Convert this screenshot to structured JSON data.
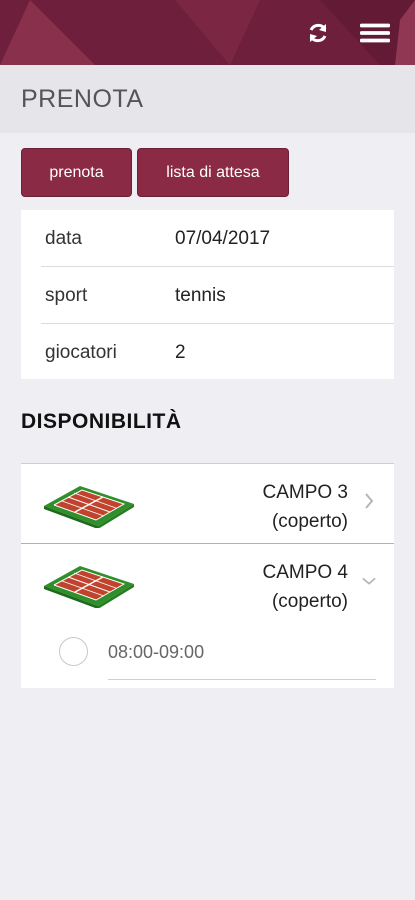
{
  "header": {
    "refresh_icon": "refresh-icon",
    "menu_icon": "hamburger-menu-icon",
    "colors": {
      "bar": "#6e1f3c",
      "accent": "#8b2a45"
    }
  },
  "page": {
    "title": "PRENOTA"
  },
  "actions": {
    "prenota_label": "prenota",
    "waitlist_label": "lista di attesa"
  },
  "booking": {
    "rows": [
      {
        "label": "data",
        "value": "07/04/2017"
      },
      {
        "label": "sport",
        "value": "tennis"
      },
      {
        "label": "giocatori",
        "value": "2"
      }
    ]
  },
  "availability": {
    "title": "DISPONIBILITÀ",
    "courts": [
      {
        "name": "CAMPO 3",
        "type": "(coperto)",
        "state": "collapsed"
      },
      {
        "name": "CAMPO 4",
        "type": "(coperto)",
        "state": "expanded",
        "slots": [
          {
            "time": "08:00-09:00",
            "selected": false
          }
        ]
      }
    ]
  }
}
